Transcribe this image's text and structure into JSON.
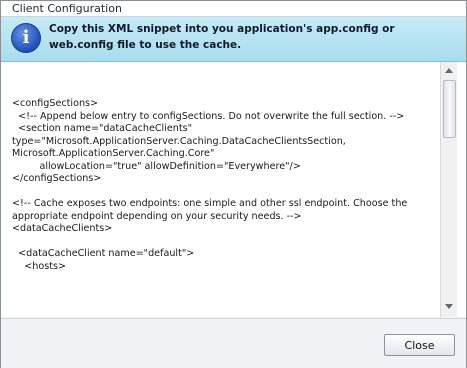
{
  "window": {
    "title": "Client Configuration"
  },
  "info": {
    "icon": "info-icon",
    "message": "Copy this XML snippet into you application's app.config or web.config file to use the cache."
  },
  "code": {
    "snippet": "<configSections>\n  <!-- Append below entry to configSections. Do not overwrite the full section. -->\n  <section name=\"dataCacheClients\" type=\"Microsoft.ApplicationServer.Caching.DataCacheClientsSection, Microsoft.ApplicationServer.Caching.Core\"\n         allowLocation=\"true\" allowDefinition=\"Everywhere\"/>\n</configSections>\n\n<!-- Cache exposes two endpoints: one simple and other ssl endpoint. Choose the appropriate endpoint depending on your security needs. -->\n<dataCacheClients>\n\n  <dataCacheClient name=\"default\">\n    <hosts>"
  },
  "footer": {
    "close_label": "Close"
  }
}
